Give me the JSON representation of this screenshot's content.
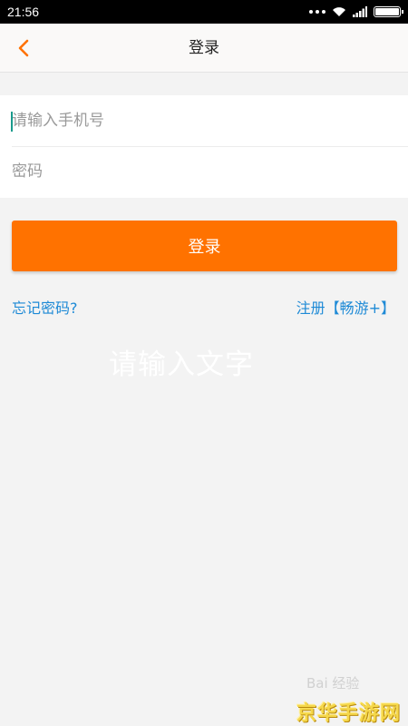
{
  "status_bar": {
    "time": "21:56"
  },
  "header": {
    "title": "登录"
  },
  "form": {
    "phone_placeholder": "请输入手机号",
    "password_placeholder": "密码"
  },
  "login_button_label": "登录",
  "links": {
    "forgot_password": "忘记密码?",
    "register": "注册【畅游+】"
  },
  "overlay_text": "请输入文字",
  "watermarks": {
    "baidu": "Bai 经验",
    "site": "京华手游网"
  },
  "colors": {
    "accent": "#ff7200",
    "link": "#1e8ad6",
    "caret": "#1a9a8c"
  }
}
